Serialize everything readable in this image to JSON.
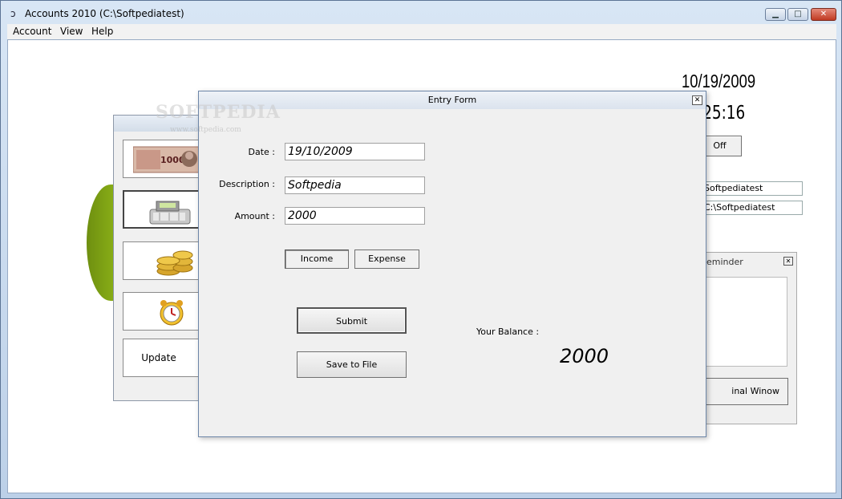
{
  "window": {
    "title": "Accounts 2010  (C:\\Softpediatest)",
    "minimize": "▁",
    "maximize": "□",
    "close": "✕"
  },
  "menu": [
    "Account",
    "View",
    "Help"
  ],
  "clock": {
    "date": "10/19/2009",
    "time": ":25:16",
    "off_label": "Off"
  },
  "paths": [
    "Softpediatest",
    "C:\\Softpediatest"
  ],
  "reminder": {
    "title": "eminder",
    "button": "inal Winow"
  },
  "side_panel": {
    "buttons": [
      {
        "icon": "banknote-icon"
      },
      {
        "icon": "cash-register-icon"
      },
      {
        "icon": "coins-icon"
      },
      {
        "icon": "alarm-clock-icon"
      },
      {
        "label": "Update"
      }
    ]
  },
  "entry_form": {
    "title": "Entry Form",
    "close": "✕",
    "date_label": "Date :",
    "date_value": "19/10/2009",
    "description_label": "Description :",
    "description_value": "Softpedia",
    "amount_label": "Amount :",
    "amount_value": "2000",
    "income_label": "Income",
    "expense_label": "Expense",
    "submit_label": "Submit",
    "save_label": "Save to File",
    "balance_label": "Your Balance :",
    "balance_value": "2000"
  },
  "watermark": {
    "text": "SOFTPEDIA",
    "url": "www.softpedia.com"
  }
}
